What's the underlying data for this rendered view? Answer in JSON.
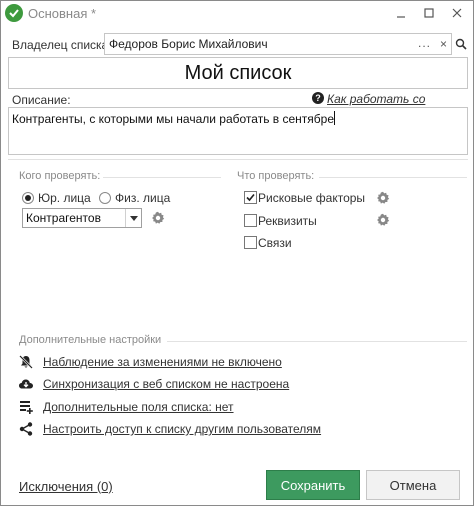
{
  "window": {
    "title": "Основная *",
    "minimize_icon": "minimize-icon",
    "maximize_icon": "maximize-icon",
    "close_icon": "close-icon",
    "app_icon": "app-logo-icon"
  },
  "owner": {
    "label": "Владелец списка:",
    "value": "Федоров Борис Михайлович",
    "dots": "...",
    "clear": "×"
  },
  "list_name": "Мой список",
  "description": {
    "label": "Описание:",
    "help_link": "Как работать со списками?",
    "value": "Контрагенты, с которыми мы начали работать в сентябре"
  },
  "who": {
    "title": "Кого проверять:",
    "options": [
      {
        "label": "Юр. лица",
        "checked": true
      },
      {
        "label": "Физ. лица",
        "checked": false
      }
    ],
    "select_value": "Контрагентов"
  },
  "what": {
    "title": "Что проверять:",
    "options": [
      {
        "label": "Рисковые факторы",
        "checked": true
      },
      {
        "label": "Реквизиты",
        "checked": false
      },
      {
        "label": "Связи",
        "checked": false
      }
    ]
  },
  "additional": {
    "title": "Дополнительные настройки",
    "items": [
      {
        "icon": "bell-off-icon",
        "label": "Наблюдение за изменениями не включено"
      },
      {
        "icon": "cloud-sync-icon",
        "label": "Синхронизация с веб списком не настроена"
      },
      {
        "icon": "list-fields-icon",
        "label": "Дополнительные поля списка: нет"
      },
      {
        "icon": "share-icon",
        "label": "Настроить доступ к списку другим пользователям"
      }
    ]
  },
  "footer": {
    "exceptions_link": "Исключения (0)",
    "save_label": "Сохранить",
    "cancel_label": "Отмена"
  },
  "colors": {
    "accent_green": "#3d9a5f",
    "border": "#c6c6c6",
    "muted_text": "#8a8a8a"
  }
}
